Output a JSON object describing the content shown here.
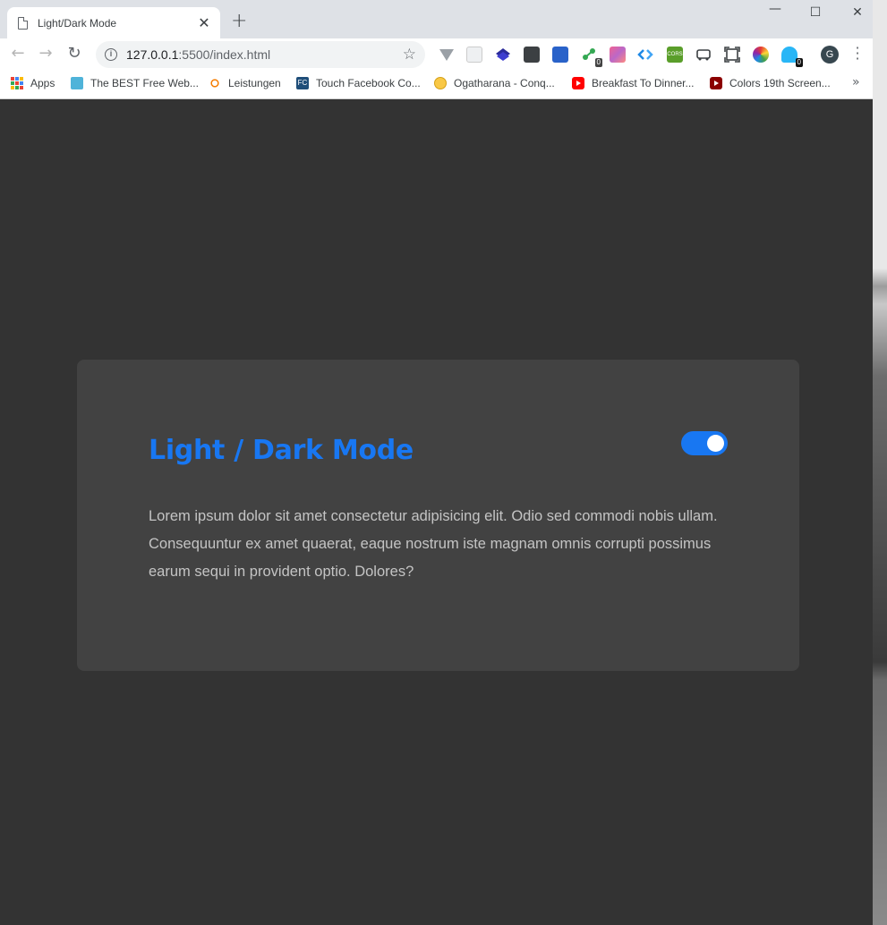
{
  "browser": {
    "tab_title": "Light/Dark Mode",
    "tab_close": "✕",
    "new_tab": "+",
    "controls": {
      "minimize": "—",
      "maximize": "☐",
      "close": "✕"
    },
    "url_host": "127.0.0.1",
    "url_rest": ":5500/index.html",
    "avatar_letter": "G",
    "extension_badges": [
      "0",
      "0"
    ],
    "bookmarks": [
      {
        "label": "Apps",
        "icon": "apps-grid-icon"
      },
      {
        "label": "The BEST Free Web...",
        "icon": "site-icon"
      },
      {
        "label": "Leistungen",
        "icon": "sun-logo-icon"
      },
      {
        "label": "Touch Facebook Co...",
        "icon": "fc-icon",
        "icon_text": "FC"
      },
      {
        "label": "Ogatharana - Conq...",
        "icon": "circle-icon"
      },
      {
        "label": "Breakfast To Dinner...",
        "icon": "youtube-icon"
      },
      {
        "label": "Colors 19th Screen...",
        "icon": "youtube-dark-icon"
      }
    ],
    "more_bookmarks": "»"
  },
  "page": {
    "title": "Light / Dark Mode",
    "body": "Lorem ipsum dolor sit amet consectetur adipisicing elit. Odio sed commodi nobis ullam. Consequuntur ex amet quaerat, eaque nostrum iste magnam omnis corrupti possimus earum sequi in provident optio. Dolores?",
    "toggle_on": true
  },
  "colors": {
    "accent": "#1877f2",
    "page_bg": "#333333",
    "card_bg": "#424242",
    "text": "#c4c4c4"
  }
}
